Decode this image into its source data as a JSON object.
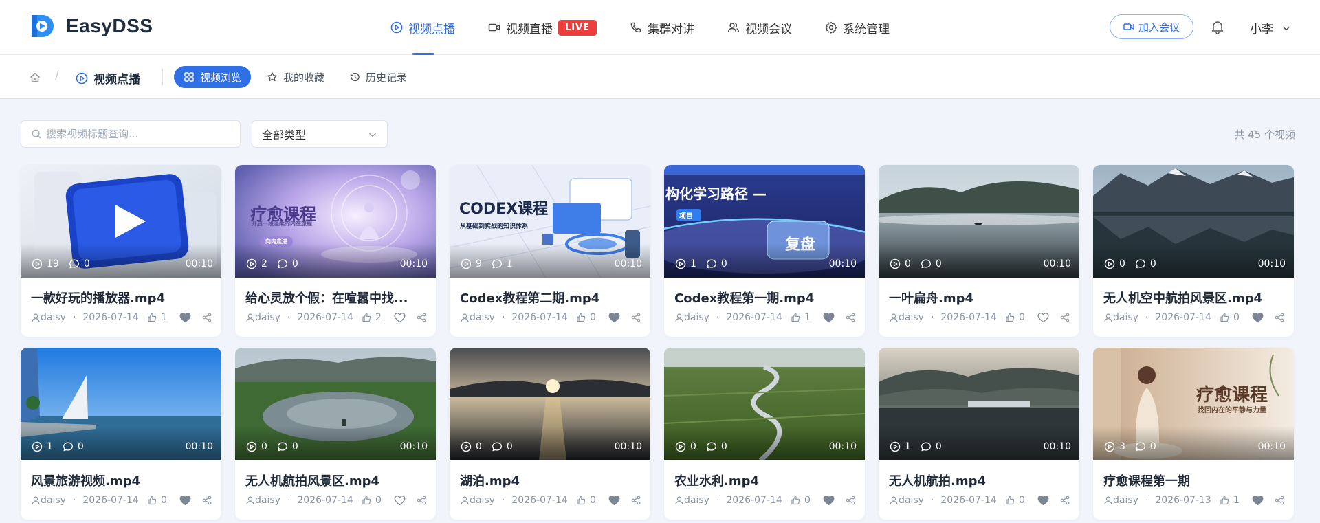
{
  "app": {
    "name": "EasyDSS",
    "brand_color": "#2f6fe5",
    "live_color": "#ef3e3e"
  },
  "nav": {
    "items": [
      {
        "label": "视频点播",
        "icon": "play-circle-icon",
        "active": true
      },
      {
        "label": "视频直播",
        "icon": "video-camera-icon",
        "badge": "LIVE"
      },
      {
        "label": "集群对讲",
        "icon": "phone-icon"
      },
      {
        "label": "视频会议",
        "icon": "users-icon"
      },
      {
        "label": "系统管理",
        "icon": "gear-icon"
      }
    ]
  },
  "header": {
    "join_label": "加入会议",
    "user_name": "小李"
  },
  "breadcrumb": {
    "current": "视频点播"
  },
  "subtabs": [
    {
      "label": "视频浏览",
      "icon": "grid-icon",
      "active": true
    },
    {
      "label": "我的收藏",
      "icon": "star-icon"
    },
    {
      "label": "历史记录",
      "icon": "history-icon"
    }
  ],
  "toolbar": {
    "search_placeholder": "搜索视频标题查询...",
    "type_select": "全部类型",
    "total_text": "共 45 个视频"
  },
  "videos": [
    {
      "title": "一款好玩的播放器.mp4",
      "plays": "19",
      "comments": "0",
      "duration": "00:10",
      "author": "daisy",
      "date": "2026-07-14",
      "likes": "1",
      "favorited": true,
      "thumb": "player-3d"
    },
    {
      "title": "给心灵放个假：在喧嚣中找...",
      "plays": "2",
      "comments": "0",
      "duration": "00:10",
      "author": "daisy",
      "date": "2026-07-14",
      "likes": "2",
      "favorited": false,
      "thumb": "meditation-purple",
      "overlay": "疗愈课程",
      "overlay_sub": "开启一段温柔的内在旅程",
      "overlay_pill": "向内走进"
    },
    {
      "title": "Codex教程第二期.mp4",
      "plays": "9",
      "comments": "1",
      "duration": "00:10",
      "author": "daisy",
      "date": "2026-07-14",
      "likes": "0",
      "favorited": true,
      "thumb": "codex-light",
      "overlay": "CODEX课程",
      "overlay_sub": "从基础到实战的知识体系"
    },
    {
      "title": "Codex教程第一期.mp4",
      "plays": "1",
      "comments": "0",
      "duration": "00:10",
      "author": "daisy",
      "date": "2026-07-14",
      "likes": "1",
      "favorited": true,
      "thumb": "codex-dark",
      "overlay": "构化学习路径 —",
      "overlay_sub": "复盘",
      "overlay_pill": "项目"
    },
    {
      "title": "一叶扁舟.mp4",
      "plays": "0",
      "comments": "0",
      "duration": "00:10",
      "author": "daisy",
      "date": "2026-07-14",
      "likes": "0",
      "favorited": false,
      "thumb": "lake-boat"
    },
    {
      "title": "无人机空中航拍风景区.mp4",
      "plays": "0",
      "comments": "0",
      "duration": "00:10",
      "author": "daisy",
      "date": "2026-07-14",
      "likes": "0",
      "favorited": true,
      "thumb": "mountain-lake"
    },
    {
      "title": "风景旅游视频.mp4",
      "plays": "1",
      "comments": "0",
      "duration": "00:10",
      "author": "daisy",
      "date": "2026-07-14",
      "likes": "0",
      "favorited": true,
      "thumb": "waterfront"
    },
    {
      "title": "无人机航拍风景区.mp4",
      "plays": "0",
      "comments": "0",
      "duration": "00:10",
      "author": "daisy",
      "date": "2026-07-14",
      "likes": "0",
      "favorited": false,
      "thumb": "green-lake"
    },
    {
      "title": "湖泊.mp4",
      "plays": "0",
      "comments": "0",
      "duration": "00:10",
      "author": "daisy",
      "date": "2026-07-14",
      "likes": "0",
      "favorited": true,
      "thumb": "sunset-lake"
    },
    {
      "title": "农业水利.mp4",
      "plays": "0",
      "comments": "0",
      "duration": "00:10",
      "author": "daisy",
      "date": "2026-07-14",
      "likes": "0",
      "favorited": true,
      "thumb": "fields-river"
    },
    {
      "title": "无人机航拍.mp4",
      "plays": "1",
      "comments": "0",
      "duration": "00:10",
      "author": "daisy",
      "date": "2026-07-14",
      "likes": "0",
      "favorited": true,
      "thumb": "misty-dam"
    },
    {
      "title": "疗愈课程第一期",
      "plays": "3",
      "comments": "0",
      "duration": "00:10",
      "author": "daisy",
      "date": "2026-07-13",
      "likes": "1",
      "favorited": true,
      "thumb": "meditation-warm",
      "overlay": "疗愈课程",
      "overlay_sub": "找回内在的平静与力量"
    }
  ]
}
